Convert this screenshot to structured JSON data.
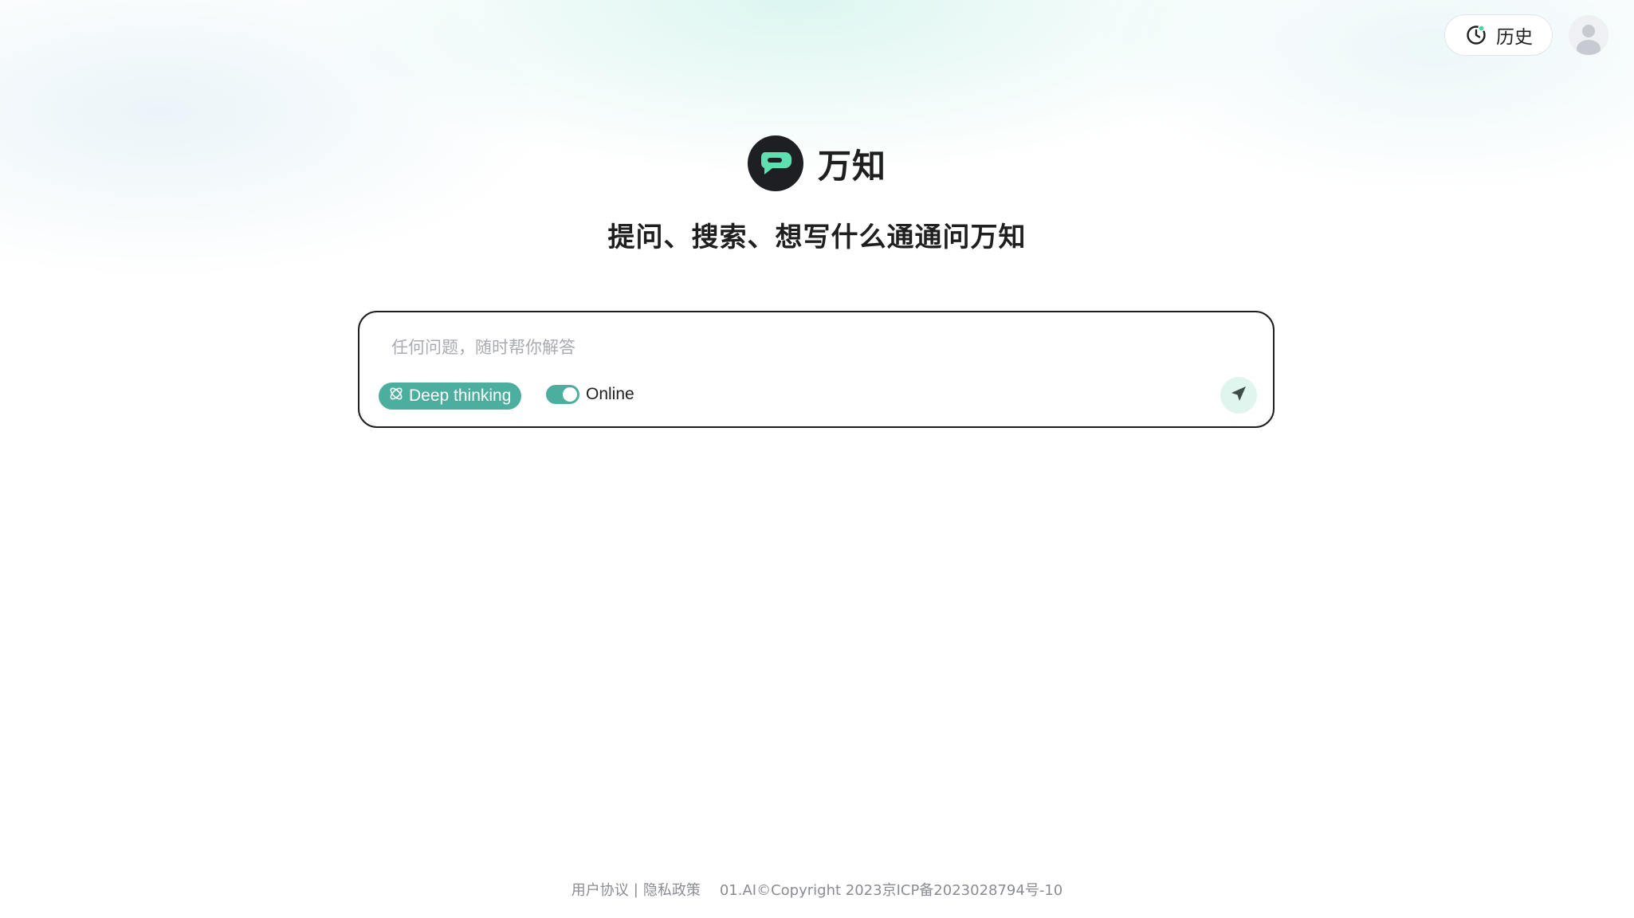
{
  "header": {
    "history_label": "历史"
  },
  "brand": {
    "name": "万知",
    "tagline": "提问、搜索、想写什么通通问万知"
  },
  "composer": {
    "placeholder": "任何问题，随时帮你解答",
    "value": "",
    "deep_thinking_label": "Deep thinking",
    "online_label": "Online",
    "online_enabled": true
  },
  "footer": {
    "terms_label": "用户协议",
    "separator": "|",
    "privacy_label": "隐私政策",
    "copyright": "01.AI©Copyright 2023京ICP备2023028794号-10"
  },
  "colors": {
    "accent": "#4cae9e",
    "send_bg": "#dff5ee",
    "logo_bg": "#1e1f22",
    "logo_mark": "#5ee0b0"
  },
  "icons": {
    "history": "clock-history-icon",
    "avatar": "user-avatar-icon",
    "logo": "chat-bubble-logo-icon",
    "deep_thinking": "atom-icon",
    "send": "paper-plane-icon"
  }
}
